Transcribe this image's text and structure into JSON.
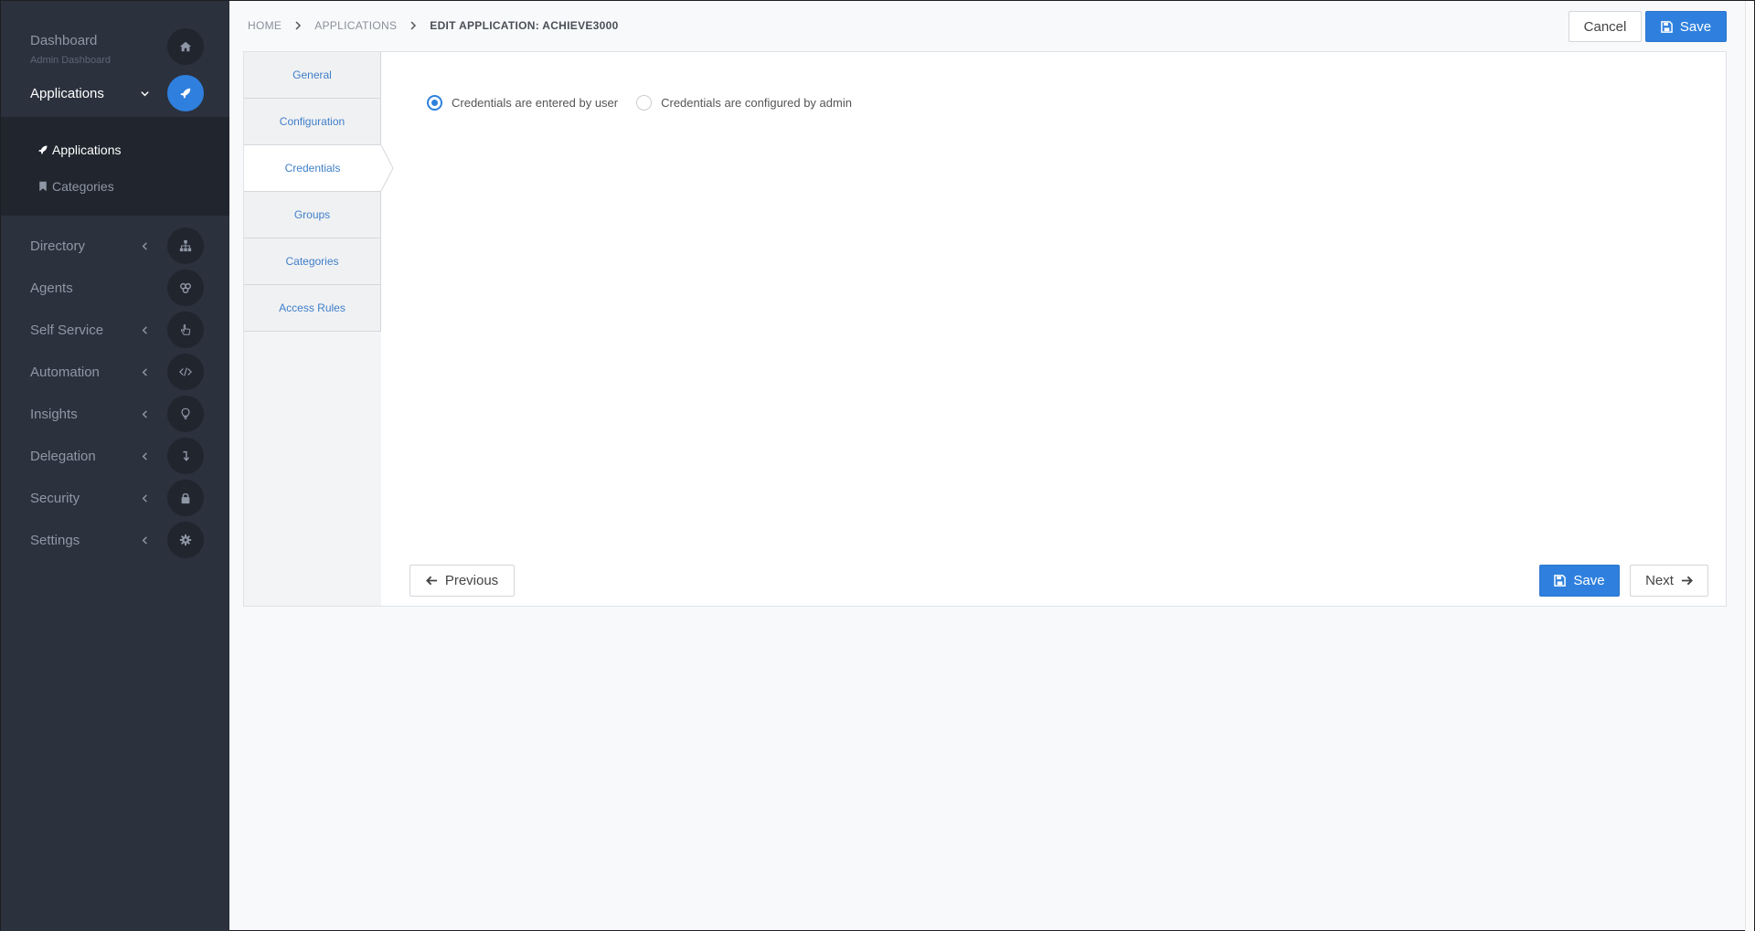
{
  "sidebar": {
    "dashboard": {
      "label": "Dashboard",
      "sub": "Admin Dashboard"
    },
    "applications": {
      "label": "Applications",
      "submenu": [
        {
          "label": "Applications",
          "icon": "rocket-icon"
        },
        {
          "label": "Categories",
          "icon": "bookmark-icon"
        }
      ]
    },
    "items": [
      {
        "label": "Directory",
        "icon": "sitemap-icon"
      },
      {
        "label": "Agents",
        "icon": "agents-icon"
      },
      {
        "label": "Self Service",
        "icon": "hand-pointer-icon"
      },
      {
        "label": "Automation",
        "icon": "code-icon"
      },
      {
        "label": "Insights",
        "icon": "lightbulb-icon"
      },
      {
        "label": "Delegation",
        "icon": "level-down-icon"
      },
      {
        "label": "Security",
        "icon": "lock-icon"
      },
      {
        "label": "Settings",
        "icon": "gear-icon"
      }
    ]
  },
  "breadcrumb": [
    "HOME",
    "APPLICATIONS",
    "EDIT APPLICATION: ACHIEVE3000"
  ],
  "header": {
    "cancel_label": "Cancel",
    "save_label": "Save"
  },
  "tabs": [
    "General",
    "Configuration",
    "Credentials",
    "Groups",
    "Categories",
    "Access Rules"
  ],
  "active_tab": "Credentials",
  "credentials": {
    "options": [
      {
        "label": "Credentials are entered by user",
        "checked": true
      },
      {
        "label": "Credentials are configured by admin",
        "checked": false
      }
    ]
  },
  "footer": {
    "previous_label": "Previous",
    "save_label": "Save",
    "next_label": "Next"
  },
  "colors": {
    "sidebar_bg": "#2b313d",
    "accent": "#2f80de",
    "link": "#3f7fc9"
  }
}
